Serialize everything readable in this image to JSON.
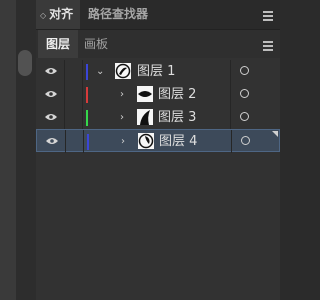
{
  "dock": {
    "tabs": [
      {
        "label": "对齐",
        "active": true,
        "icon": "updown-arrows-icon"
      },
      {
        "label": "路径查找器",
        "active": false
      }
    ]
  },
  "panel": {
    "tabs": [
      {
        "label": "图层",
        "active": true
      },
      {
        "label": "画板",
        "active": false
      }
    ]
  },
  "layers": [
    {
      "name": "图层 1",
      "color": "#3b46d8",
      "expanded": true,
      "level": 0,
      "selected": false
    },
    {
      "name": "图层 2",
      "color": "#d83b3b",
      "expanded": false,
      "level": 1,
      "selected": false
    },
    {
      "name": "图层 3",
      "color": "#35d84b",
      "expanded": false,
      "level": 1,
      "selected": false
    },
    {
      "name": "图层 4",
      "color": "#3b46d8",
      "expanded": false,
      "level": 1,
      "selected": true
    }
  ]
}
